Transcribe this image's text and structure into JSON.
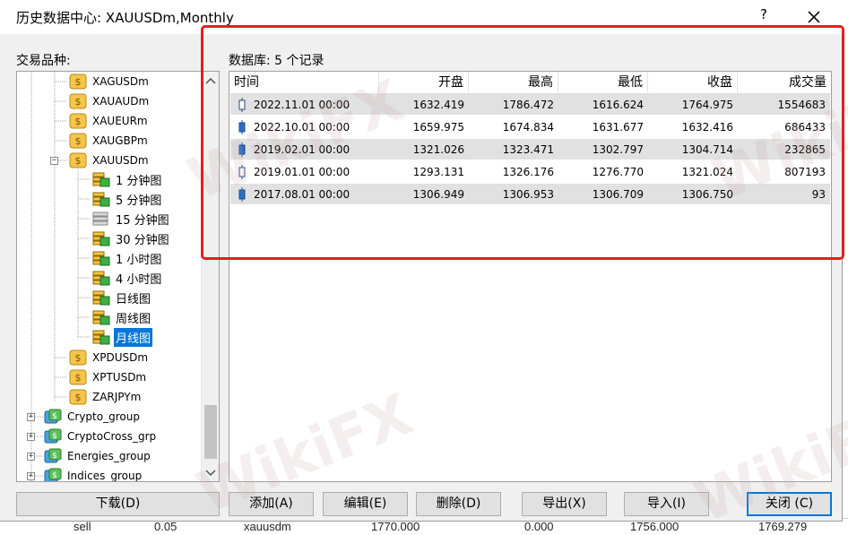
{
  "background_row": {
    "cells": [
      "sell",
      "0.05",
      "xauusdm",
      "1770.000",
      "0.000",
      "1756.000",
      "1769.279"
    ]
  },
  "dialog": {
    "title": "历史数据中心: XAUUSDm,Monthly",
    "help_label": "?",
    "symbols_label": "交易品种:",
    "db_label": "数据库: 5 个记录"
  },
  "tree": {
    "symbols_top": [
      "XAGUSDm",
      "XAUAUDm",
      "XAUEURm",
      "XAUGBPm",
      "XAUUSDm"
    ],
    "timeframes": [
      "1 分钟图",
      "5 分钟图",
      "15 分钟图",
      "30 分钟图",
      "1 小时图",
      "4 小时图",
      "日线图",
      "周线图",
      "月线图"
    ],
    "symbols_bottom": [
      "XPDUSDm",
      "XPTUSDm",
      "ZARJPYm"
    ],
    "groups": [
      "Crypto_group",
      "CryptoCross_grp",
      "Energies_group",
      "Indices_group"
    ],
    "selected": "月线图"
  },
  "table": {
    "headers": [
      "时间",
      "开盘",
      "最高",
      "最低",
      "收盘",
      "成交量"
    ],
    "rows": [
      [
        "2022.11.01 00:00",
        "1632.419",
        "1786.472",
        "1616.624",
        "1764.975",
        "1554683"
      ],
      [
        "2022.10.01 00:00",
        "1659.975",
        "1674.834",
        "1631.677",
        "1632.416",
        "686433"
      ],
      [
        "2019.02.01 00:00",
        "1321.026",
        "1323.471",
        "1302.797",
        "1304.714",
        "232865"
      ],
      [
        "2019.01.01 00:00",
        "1293.131",
        "1326.176",
        "1276.770",
        "1321.024",
        "807193"
      ],
      [
        "2017.08.01 00:00",
        "1306.949",
        "1306.953",
        "1306.709",
        "1306.750",
        "93"
      ]
    ]
  },
  "buttons": {
    "download": "下载(D)",
    "add": "添加(A)",
    "edit": "编辑(E)",
    "delete": "删除(D)",
    "export": "导出(X)",
    "import": "导入(I)",
    "close": "关闭 (C)"
  },
  "watermark": "WikiFX",
  "colors": {
    "highlight": "#e02020",
    "selection": "#0078d7",
    "row_alt": "#e1e1e1"
  }
}
